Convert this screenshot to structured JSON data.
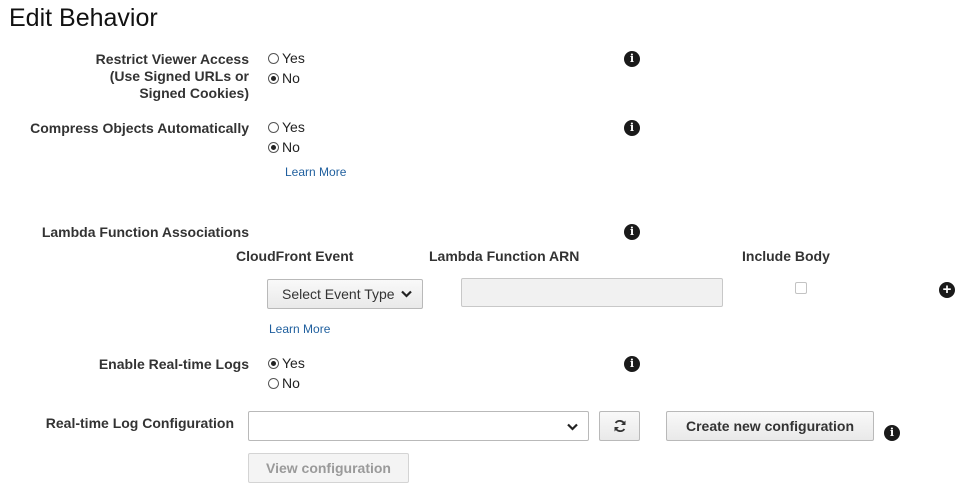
{
  "page": {
    "title": "Edit Behavior"
  },
  "restrict_viewer_access": {
    "label_line1": "Restrict Viewer Access",
    "label_line2": "(Use Signed URLs or",
    "label_line3": "Signed Cookies)",
    "options": [
      "Yes",
      "No"
    ],
    "selected": "No"
  },
  "compress_objects": {
    "label": "Compress Objects Automatically",
    "options": [
      "Yes",
      "No"
    ],
    "selected": "No",
    "learn_more": "Learn More"
  },
  "lambda": {
    "label": "Lambda Function Associations",
    "columns": {
      "event": "CloudFront Event",
      "arn": "Lambda Function ARN",
      "include_body": "Include Body"
    },
    "event_select": {
      "value": "Select Event Type"
    },
    "arn_input": {
      "value": ""
    },
    "include_body_checked": false,
    "learn_more": "Learn More"
  },
  "realtime_logs": {
    "label": "Enable Real-time Logs",
    "options": [
      "Yes",
      "No"
    ],
    "selected": "Yes"
  },
  "realtime_config": {
    "label": "Real-time Log Configuration",
    "select_value": "",
    "create_button": "Create new configuration",
    "view_button": "View configuration"
  },
  "icons": {
    "info": "info-icon",
    "refresh": "refresh-icon",
    "chevron": "chevron-down-icon",
    "add": "plus-circle-icon"
  },
  "colors": {
    "link": "#1f5f9e",
    "text": "#333333",
    "icon": "#1a1a1a"
  }
}
